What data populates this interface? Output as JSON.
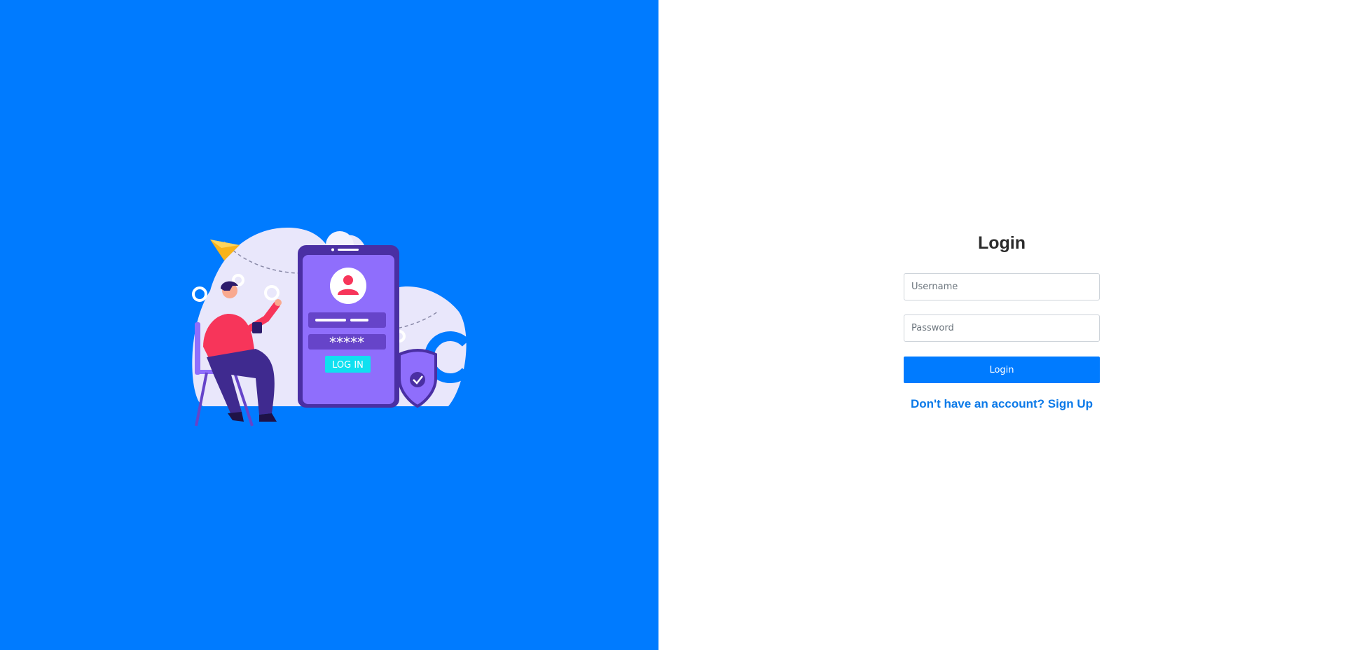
{
  "left_panel": {
    "illustration": {
      "name": "login-illustration",
      "button_label": "LOG IN",
      "password_mask": "*****"
    }
  },
  "login": {
    "title": "Login",
    "username_placeholder": "Username",
    "password_placeholder": "Password",
    "submit_label": "Login",
    "signup_link": "Don't have an account? Sign Up"
  },
  "colors": {
    "primary": "#007bff",
    "title": "#2b2b2b",
    "link": "#0a79e8",
    "phone": "#8f6efc",
    "phone_dark": "#4a2fa3",
    "person_shirt": "#f7355a",
    "plane": "#f9b31b",
    "cloud": "#e9e7fb",
    "accent_cyan": "#10e0f0"
  }
}
